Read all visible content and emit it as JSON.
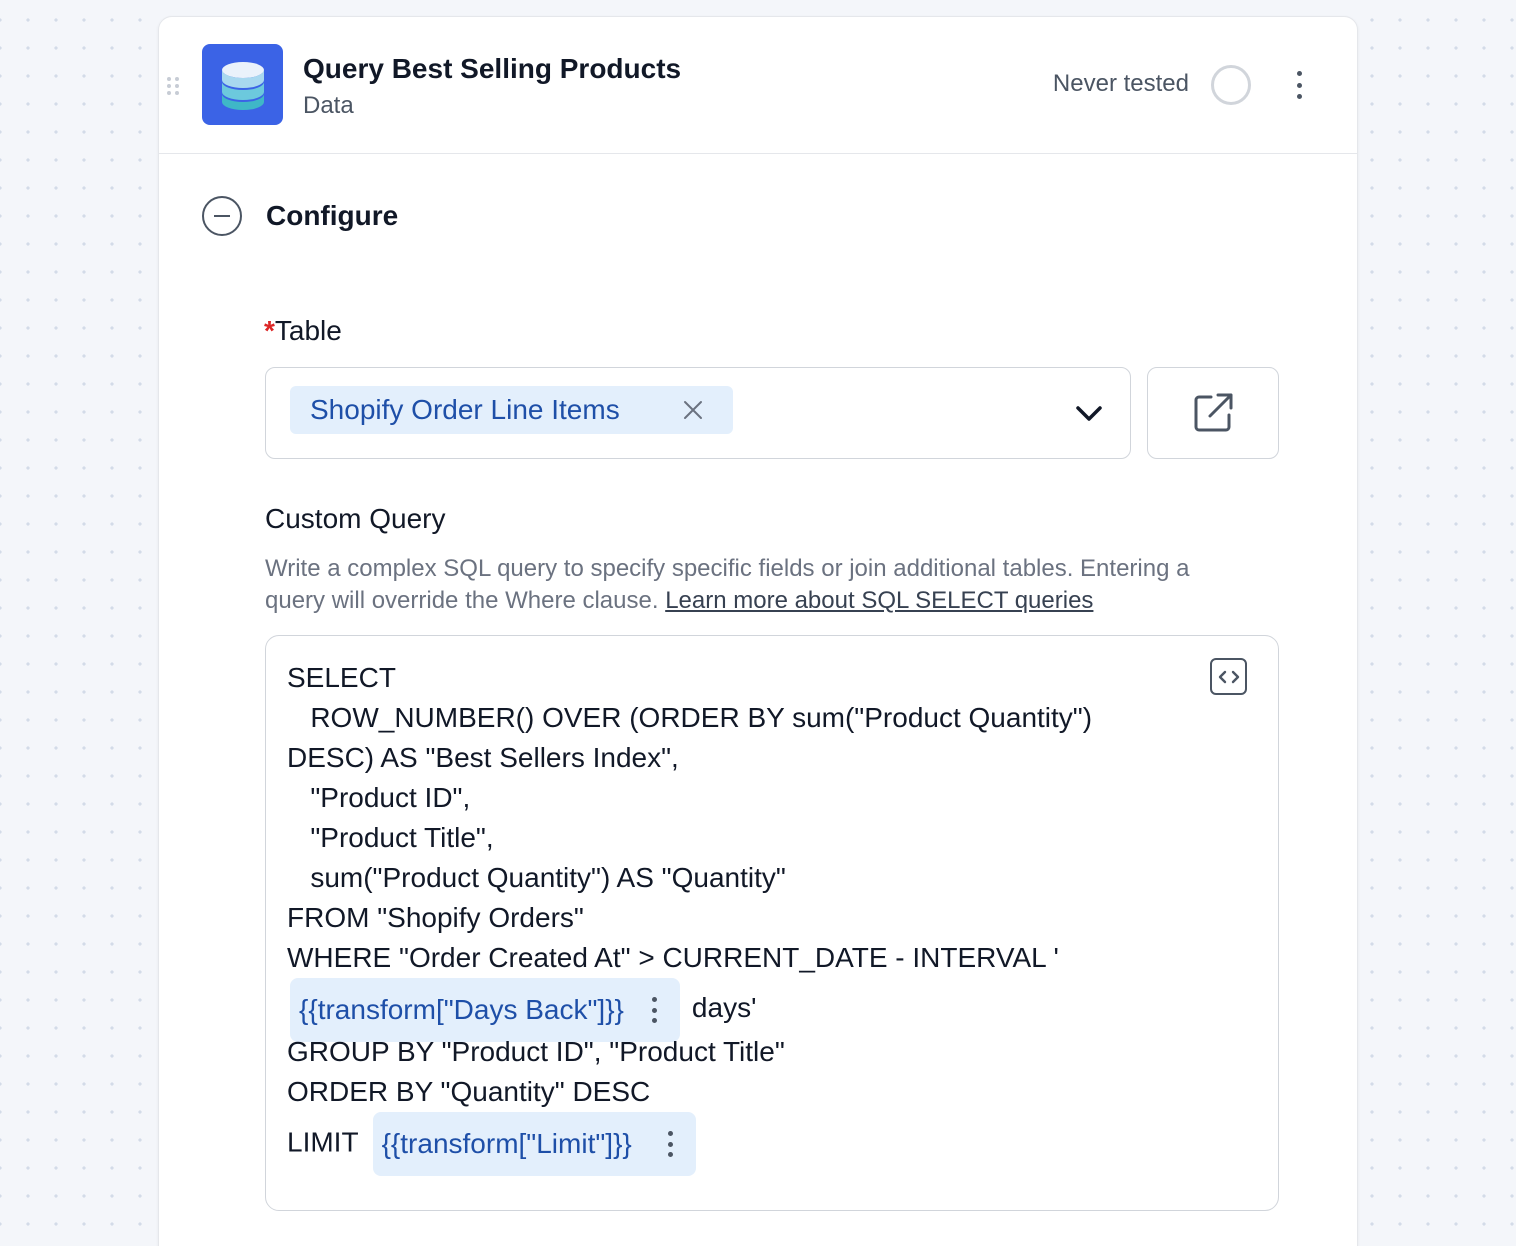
{
  "step": {
    "title": "Query Best Selling Products",
    "subtitle": "Data",
    "status": "Never tested",
    "brand_color": "#3b63e6"
  },
  "section": {
    "title": "Configure"
  },
  "table_field": {
    "required_mark": "*",
    "label": "Table",
    "selected_value": "Shopify Order Line Items"
  },
  "custom_query": {
    "label": "Custom Query",
    "description": "Write a complex SQL query to specify specific fields or join additional tables. Entering a query will override the Where clause.",
    "link_text": "Learn more about SQL SELECT queries",
    "lines": [
      "SELECT",
      "   ROW_NUMBER() OVER (ORDER BY sum(\"Product Quantity\")",
      "DESC) AS \"Best Sellers Index\",",
      "   \"Product ID\",",
      "   \"Product Title\",",
      "   sum(\"Product Quantity\") AS \"Quantity\"",
      "FROM \"Shopify Orders\"",
      "WHERE \"Order Created At\" > CURRENT_DATE - INTERVAL '"
    ],
    "token_days_back": "{{transform[\"Days Back\"]}}",
    "after_days_back": "days'",
    "lines_after": [
      "GROUP BY \"Product ID\", \"Product Title\"",
      "ORDER BY \"Quantity\" DESC"
    ],
    "limit_keyword": "LIMIT",
    "token_limit": "{{transform[\"Limit\"]}}"
  },
  "icons": {
    "app": "database-icon",
    "status": "status-circle-icon",
    "menu": "kebab-menu-icon",
    "collapse": "collapse-minus-icon",
    "clear": "close-icon",
    "dropdown": "chevron-down-icon",
    "external": "external-link-icon",
    "code": "code-icon"
  }
}
